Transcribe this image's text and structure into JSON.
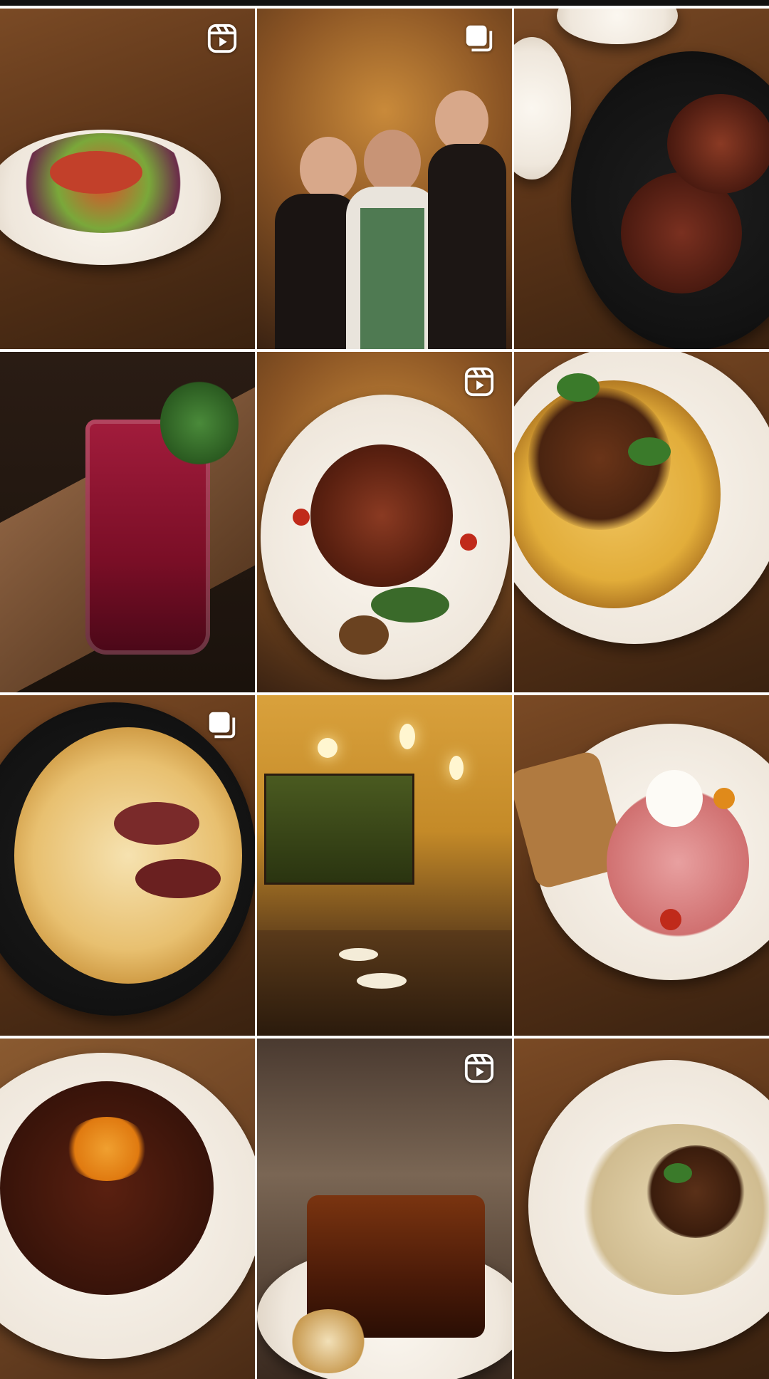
{
  "grid": {
    "tiles": [
      {
        "name": "octopus-salad-post",
        "badge": "reel"
      },
      {
        "name": "chefs-team-photo-post",
        "badge": "carousel"
      },
      {
        "name": "grilled-steak-post",
        "badge": "none"
      },
      {
        "name": "berry-cocktail-post",
        "badge": "none"
      },
      {
        "name": "grilled-octopus-plate-post",
        "badge": "reel"
      },
      {
        "name": "beef-ragu-tagliatelle-post",
        "badge": "none"
      },
      {
        "name": "gnocchi-skillet-post",
        "badge": "carousel"
      },
      {
        "name": "private-dining-room-post",
        "badge": "none"
      },
      {
        "name": "burrata-prosciutto-post",
        "badge": "none"
      },
      {
        "name": "chocolate-cake-dessert-post",
        "badge": "none"
      },
      {
        "name": "glazed-pork-belly-post",
        "badge": "reel"
      },
      {
        "name": "mushroom-risotto-post",
        "badge": "none"
      }
    ]
  },
  "icons": {
    "reel": "reels-icon",
    "carousel": "carousel-icon"
  },
  "colors": {
    "badge": "#ffffff",
    "gutter": "#ffffff"
  }
}
